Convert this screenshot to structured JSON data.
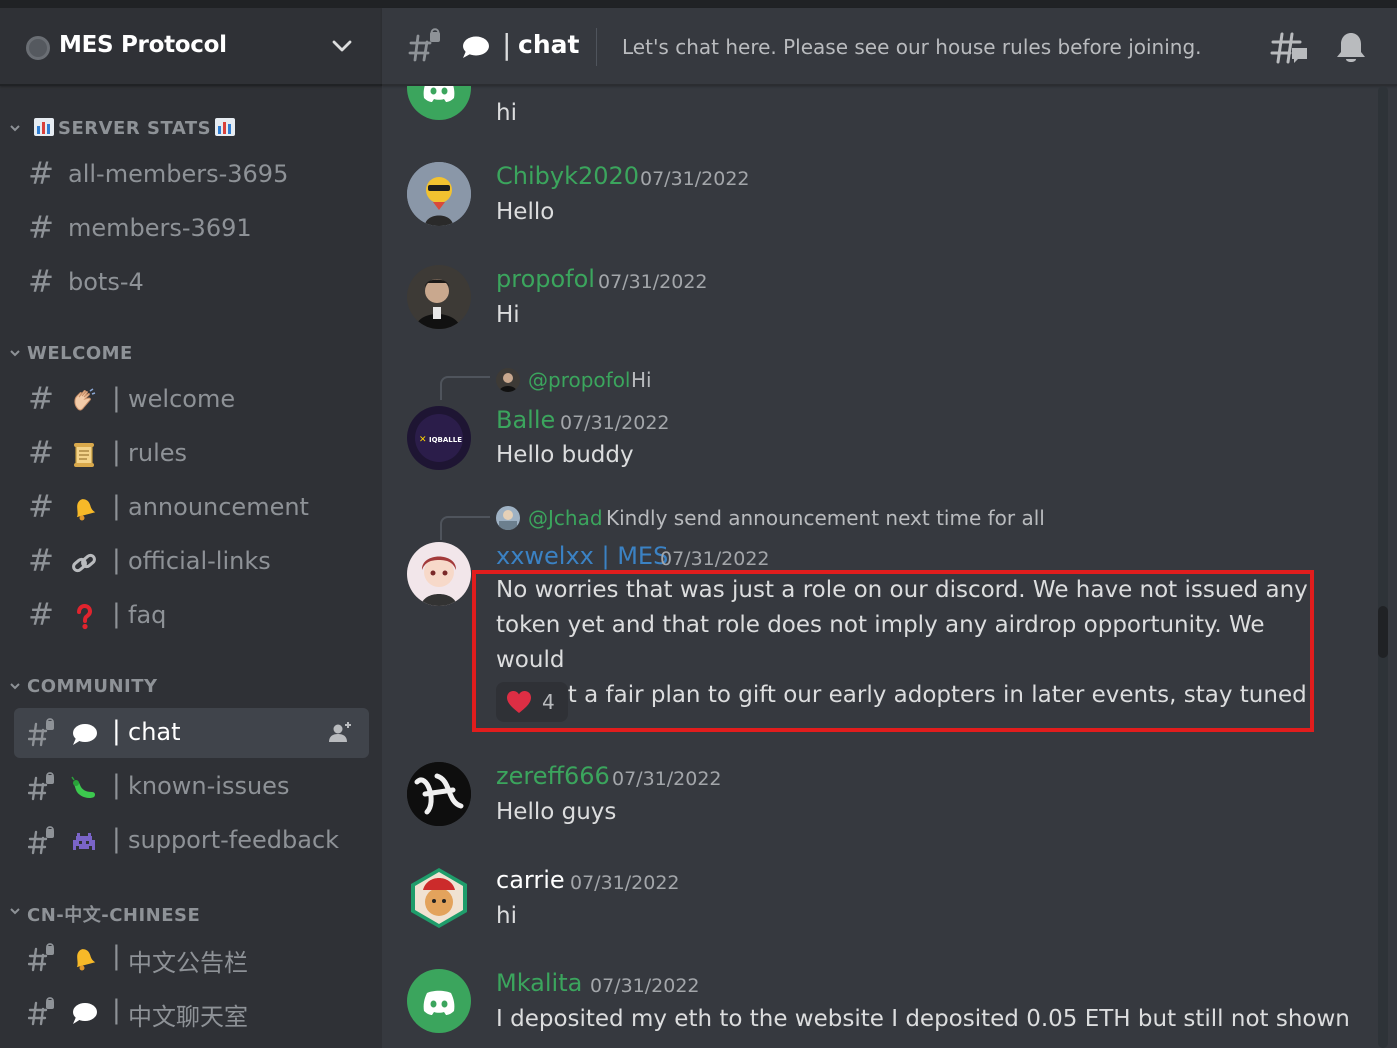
{
  "server": {
    "name": "MES Protocol"
  },
  "categories": {
    "server_stats": "SERVER STATS",
    "welcome": "WELCOME",
    "community": "COMMUNITY",
    "chinese": "CN-中文-CHINESE"
  },
  "channels": {
    "stats": [
      "all-members-3695",
      "members-3691",
      "bots-4"
    ],
    "welcome": [
      "welcome",
      "rules",
      "announcement",
      "official-links",
      "faq"
    ],
    "community": [
      "chat",
      "known-issues",
      "support-feedback"
    ],
    "chinese": [
      "中文公告栏",
      "中文聊天室"
    ],
    "pipe": "|"
  },
  "header": {
    "channel_name": "chat",
    "pipe": "|",
    "topic": "Let's chat here. Please see our house rules before joining."
  },
  "messages": [
    {
      "user": "",
      "timestamp": "",
      "text": "hi"
    },
    {
      "user": "Chibyk2020",
      "timestamp": "07/31/2022",
      "text": "Hello"
    },
    {
      "user": "propofol",
      "timestamp": "07/31/2022",
      "text": "Hi"
    },
    {
      "reply_user": "@propofol",
      "reply_text": "Hi",
      "user": "Balle",
      "timestamp": "07/31/2022",
      "text": "Hello buddy"
    },
    {
      "reply_user": "@Jchad",
      "reply_text": "Kindly send announcement next time for all",
      "user": "xxwelxx | MES",
      "timestamp": "07/31/2022",
      "lines": [
        "No worries that was just a role on our discord. We have not issued any",
        "token yet and that role does not imply any airdrop opportunity. We would",
        "roll out a fair plan to gift our early adopters in later events, stay tuned!"
      ],
      "reaction_count": "4"
    },
    {
      "user": "zereff666",
      "timestamp": "07/31/2022",
      "text": "Hello guys"
    },
    {
      "user": "carrie",
      "timestamp": "07/31/2022",
      "text": "hi"
    },
    {
      "user": "Mkalita",
      "timestamp": "07/31/2022",
      "text": "I deposited my eth to the website I deposited 0.05 ETH but still not shown"
    }
  ],
  "colors": {
    "username_green": "#3ba55d",
    "username_blue": "#3b82c4",
    "username_white": "#ffffff",
    "highlight_red": "#e11d1d",
    "discord_green": "#3ba55d"
  },
  "icons": {
    "server_logo": "server-logo-icon",
    "chevron": "chevron-down-icon",
    "hash": "hash-icon",
    "thread_hash": "thread-hash-icon",
    "threads": "threads-icon",
    "bell": "bell-icon",
    "invite": "add-member-icon",
    "reaction": "heart-emoji-icon"
  }
}
